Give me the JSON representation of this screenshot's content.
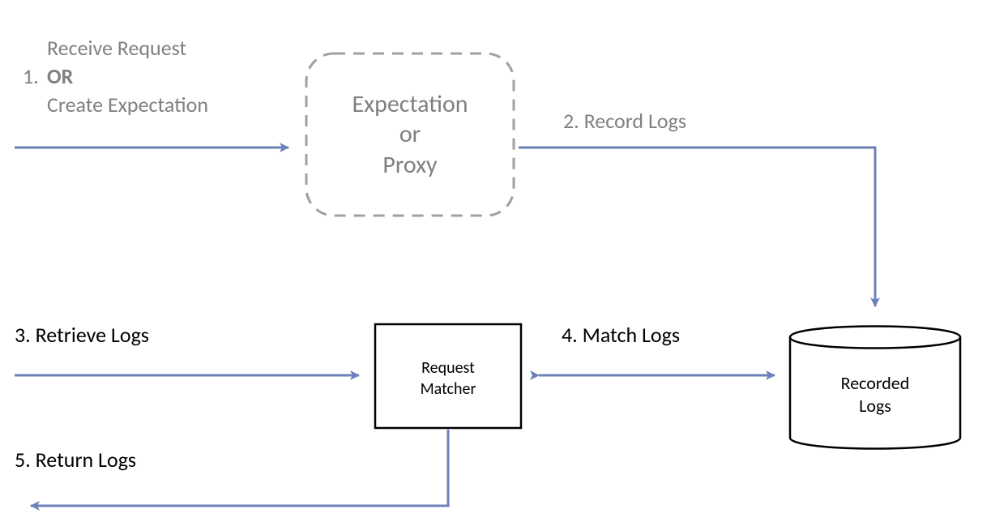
{
  "step1": {
    "number": "1.",
    "line1": "Receive Request",
    "line2": "OR",
    "line3": "Create Expectation"
  },
  "box_expectation": {
    "line1": "Expectation",
    "line2": "or",
    "line3": "Proxy"
  },
  "step2": {
    "label": "2. Record Logs"
  },
  "step3": {
    "label": "3. Retrieve Logs"
  },
  "box_matcher": {
    "line1": "Request",
    "line2": "Matcher"
  },
  "step4": {
    "label": "4. Match Logs"
  },
  "cyl_logs": {
    "line1": "Recorded",
    "line2": "Logs"
  },
  "step5": {
    "label": "5. Return Logs"
  },
  "colors": {
    "arrow": "#6a82b8",
    "grey": "#808080"
  }
}
